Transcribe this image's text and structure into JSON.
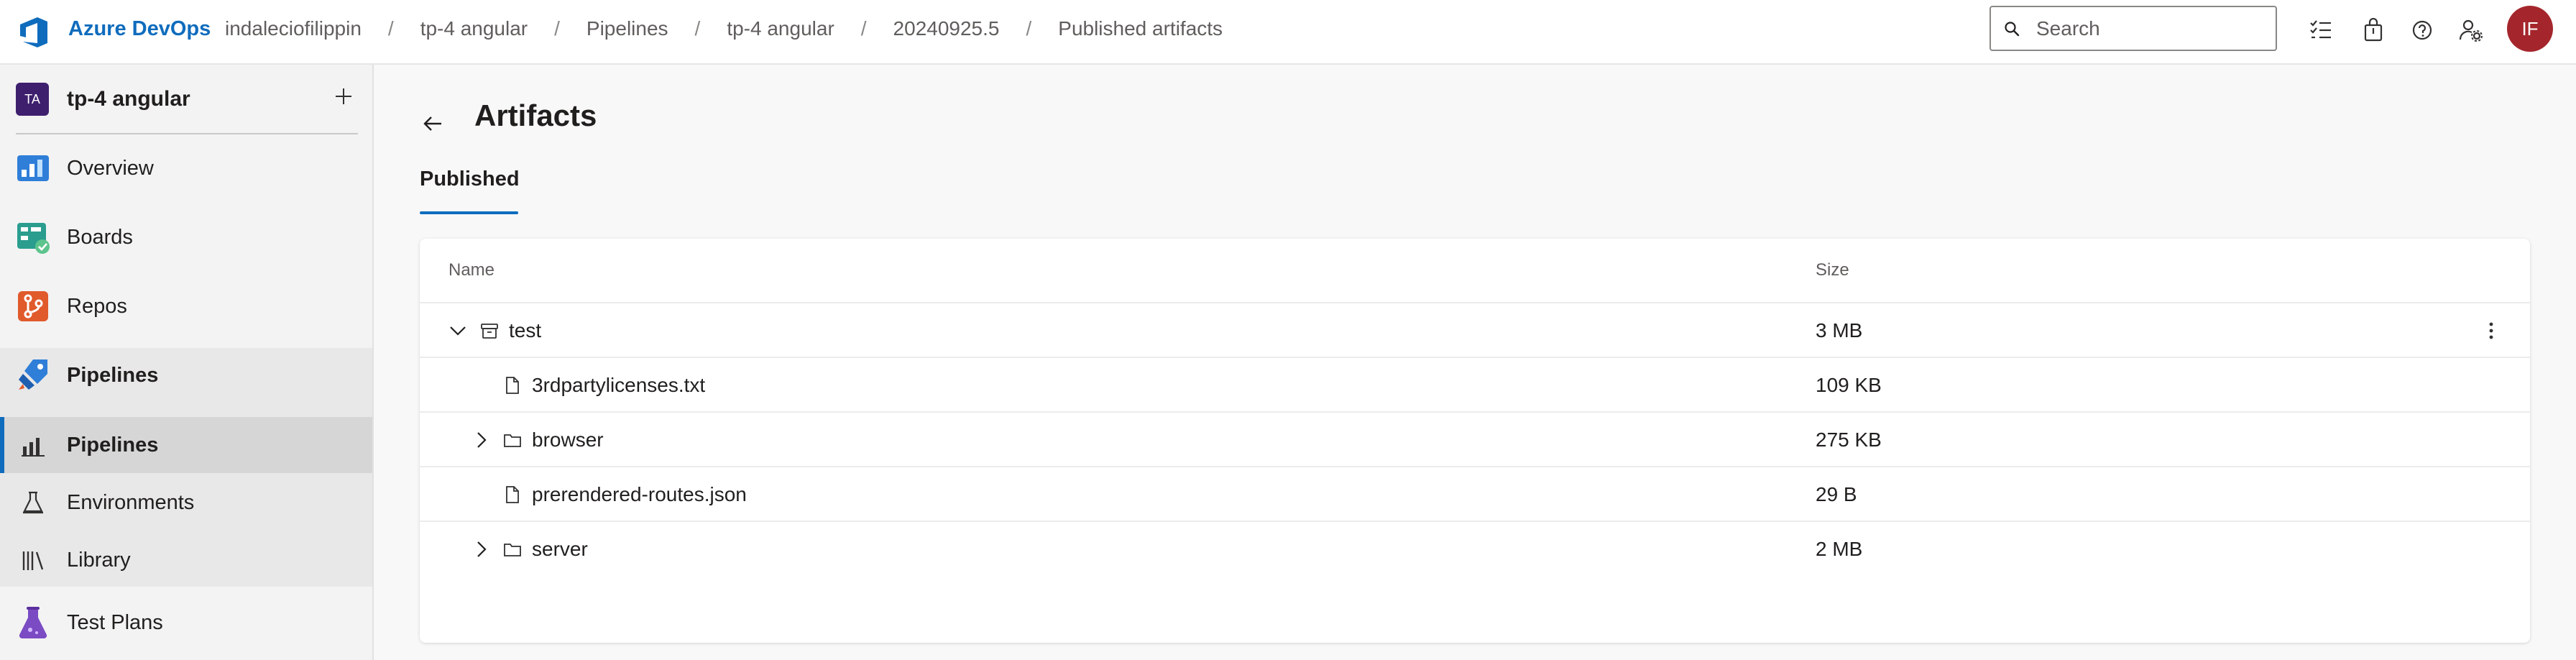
{
  "header": {
    "brand": "Azure DevOps",
    "breadcrumbs": [
      "indaleciofilippin",
      "tp-4 angular",
      "Pipelines",
      "tp-4 angular",
      "20240925.5",
      "Published artifacts"
    ],
    "separator": "/",
    "search_placeholder": "Search",
    "avatar_initials": "IF",
    "accent_color": "#0f6cbd",
    "avatar_color": "#a4262c",
    "icons": [
      "task-list-icon",
      "shopping-bag-icon",
      "help-icon",
      "user-settings-icon"
    ]
  },
  "sidebar": {
    "project_badge": "TA",
    "project_name": "tp-4 angular",
    "add_label": "+",
    "items": [
      {
        "label": "Overview",
        "icon": "overview-icon"
      },
      {
        "label": "Boards",
        "icon": "boards-icon"
      },
      {
        "label": "Repos",
        "icon": "repos-icon"
      },
      {
        "label": "Pipelines",
        "icon": "pipelines-icon"
      },
      {
        "label": "Pipelines",
        "icon": "pipelines-sub-icon",
        "active": true
      },
      {
        "label": "Environments",
        "icon": "environments-icon"
      },
      {
        "label": "Library",
        "icon": "library-icon"
      },
      {
        "label": "Test Plans",
        "icon": "test-plans-icon"
      }
    ]
  },
  "main": {
    "title": "Artifacts",
    "tab": "Published",
    "columns": {
      "name": "Name",
      "size": "Size"
    },
    "rows": [
      {
        "name": "test",
        "size": "3 MB",
        "type": "artifact",
        "expanded": true
      },
      {
        "name": "3rdpartylicenses.txt",
        "size": "109 KB",
        "type": "file"
      },
      {
        "name": "browser",
        "size": "275 KB",
        "type": "folder",
        "expanded": false
      },
      {
        "name": "prerendered-routes.json",
        "size": "29 B",
        "type": "file"
      },
      {
        "name": "server",
        "size": "2 MB",
        "type": "folder",
        "expanded": false
      }
    ]
  }
}
